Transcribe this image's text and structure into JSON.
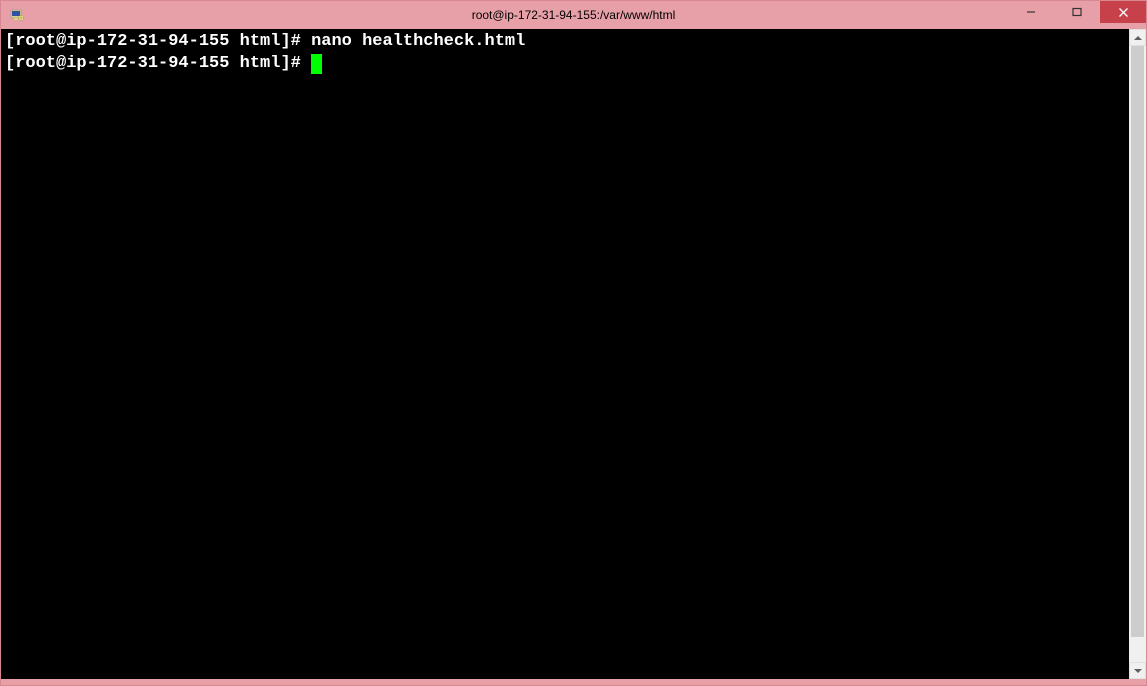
{
  "titlebar": {
    "title": "root@ip-172-31-94-155:/var/www/html"
  },
  "terminal": {
    "lines": [
      {
        "prompt": "[root@ip-172-31-94-155 html]# ",
        "command": "nano healthcheck.html"
      },
      {
        "prompt": "[root@ip-172-31-94-155 html]# ",
        "command": ""
      }
    ]
  }
}
